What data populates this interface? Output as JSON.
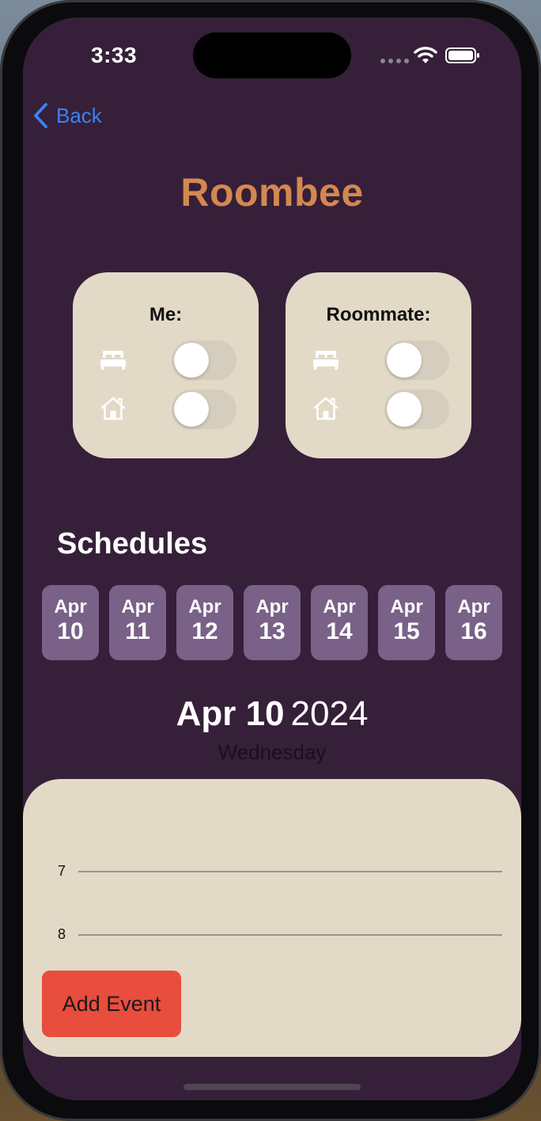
{
  "status_bar": {
    "time": "3:33"
  },
  "nav": {
    "back_label": "Back"
  },
  "app": {
    "title": "Roombee"
  },
  "cards": {
    "me": {
      "title": "Me:",
      "sleeping": false,
      "home": false
    },
    "roommate": {
      "title": "Roommate:",
      "sleeping": false,
      "home": false
    }
  },
  "schedules": {
    "title": "Schedules",
    "dates": [
      {
        "month": "Apr",
        "day": "10"
      },
      {
        "month": "Apr",
        "day": "11"
      },
      {
        "month": "Apr",
        "day": "12"
      },
      {
        "month": "Apr",
        "day": "13"
      },
      {
        "month": "Apr",
        "day": "14"
      },
      {
        "month": "Apr",
        "day": "15"
      },
      {
        "month": "Apr",
        "day": "16"
      }
    ]
  },
  "selected": {
    "month_day": "Apr 10",
    "year": "2024",
    "weekday": "Wednesday"
  },
  "timeline": {
    "hours": [
      "7",
      "8"
    ]
  },
  "actions": {
    "add_event": "Add Event"
  },
  "colors": {
    "background": "#361f39",
    "title": "#d48850",
    "card": "#e3d9c7",
    "date_chip": "#796187",
    "add_event": "#e84d3d",
    "back_link": "#3b82f6"
  },
  "icons": {
    "back": "chevron-left-icon",
    "sleep": "bed-icon",
    "home": "house-icon",
    "wifi": "wifi-icon",
    "battery": "battery-icon"
  }
}
